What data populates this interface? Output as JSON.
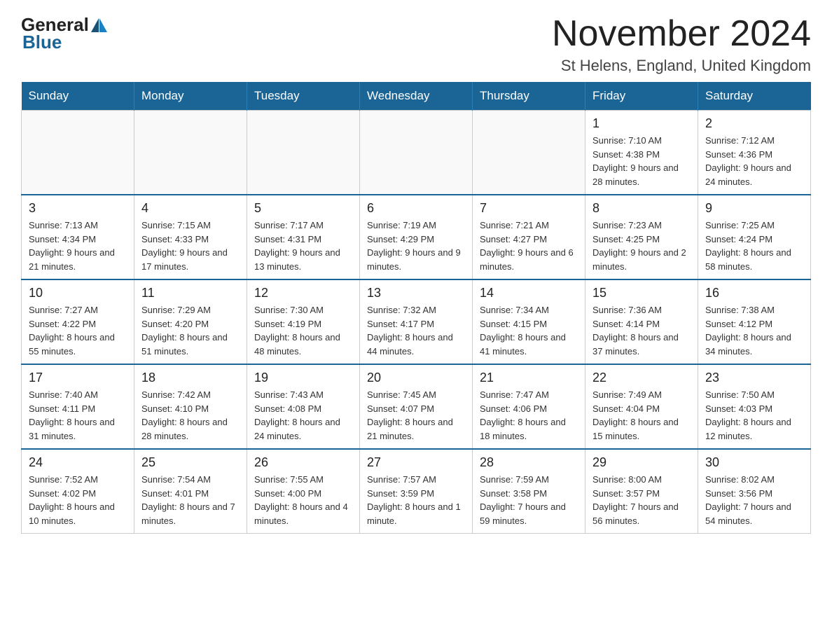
{
  "header": {
    "logo_general": "General",
    "logo_blue": "Blue",
    "month_title": "November 2024",
    "location": "St Helens, England, United Kingdom"
  },
  "calendar": {
    "days_of_week": [
      "Sunday",
      "Monday",
      "Tuesday",
      "Wednesday",
      "Thursday",
      "Friday",
      "Saturday"
    ],
    "weeks": [
      [
        {
          "day": "",
          "info": ""
        },
        {
          "day": "",
          "info": ""
        },
        {
          "day": "",
          "info": ""
        },
        {
          "day": "",
          "info": ""
        },
        {
          "day": "",
          "info": ""
        },
        {
          "day": "1",
          "info": "Sunrise: 7:10 AM\nSunset: 4:38 PM\nDaylight: 9 hours and 28 minutes."
        },
        {
          "day": "2",
          "info": "Sunrise: 7:12 AM\nSunset: 4:36 PM\nDaylight: 9 hours and 24 minutes."
        }
      ],
      [
        {
          "day": "3",
          "info": "Sunrise: 7:13 AM\nSunset: 4:34 PM\nDaylight: 9 hours and 21 minutes."
        },
        {
          "day": "4",
          "info": "Sunrise: 7:15 AM\nSunset: 4:33 PM\nDaylight: 9 hours and 17 minutes."
        },
        {
          "day": "5",
          "info": "Sunrise: 7:17 AM\nSunset: 4:31 PM\nDaylight: 9 hours and 13 minutes."
        },
        {
          "day": "6",
          "info": "Sunrise: 7:19 AM\nSunset: 4:29 PM\nDaylight: 9 hours and 9 minutes."
        },
        {
          "day": "7",
          "info": "Sunrise: 7:21 AM\nSunset: 4:27 PM\nDaylight: 9 hours and 6 minutes."
        },
        {
          "day": "8",
          "info": "Sunrise: 7:23 AM\nSunset: 4:25 PM\nDaylight: 9 hours and 2 minutes."
        },
        {
          "day": "9",
          "info": "Sunrise: 7:25 AM\nSunset: 4:24 PM\nDaylight: 8 hours and 58 minutes."
        }
      ],
      [
        {
          "day": "10",
          "info": "Sunrise: 7:27 AM\nSunset: 4:22 PM\nDaylight: 8 hours and 55 minutes."
        },
        {
          "day": "11",
          "info": "Sunrise: 7:29 AM\nSunset: 4:20 PM\nDaylight: 8 hours and 51 minutes."
        },
        {
          "day": "12",
          "info": "Sunrise: 7:30 AM\nSunset: 4:19 PM\nDaylight: 8 hours and 48 minutes."
        },
        {
          "day": "13",
          "info": "Sunrise: 7:32 AM\nSunset: 4:17 PM\nDaylight: 8 hours and 44 minutes."
        },
        {
          "day": "14",
          "info": "Sunrise: 7:34 AM\nSunset: 4:15 PM\nDaylight: 8 hours and 41 minutes."
        },
        {
          "day": "15",
          "info": "Sunrise: 7:36 AM\nSunset: 4:14 PM\nDaylight: 8 hours and 37 minutes."
        },
        {
          "day": "16",
          "info": "Sunrise: 7:38 AM\nSunset: 4:12 PM\nDaylight: 8 hours and 34 minutes."
        }
      ],
      [
        {
          "day": "17",
          "info": "Sunrise: 7:40 AM\nSunset: 4:11 PM\nDaylight: 8 hours and 31 minutes."
        },
        {
          "day": "18",
          "info": "Sunrise: 7:42 AM\nSunset: 4:10 PM\nDaylight: 8 hours and 28 minutes."
        },
        {
          "day": "19",
          "info": "Sunrise: 7:43 AM\nSunset: 4:08 PM\nDaylight: 8 hours and 24 minutes."
        },
        {
          "day": "20",
          "info": "Sunrise: 7:45 AM\nSunset: 4:07 PM\nDaylight: 8 hours and 21 minutes."
        },
        {
          "day": "21",
          "info": "Sunrise: 7:47 AM\nSunset: 4:06 PM\nDaylight: 8 hours and 18 minutes."
        },
        {
          "day": "22",
          "info": "Sunrise: 7:49 AM\nSunset: 4:04 PM\nDaylight: 8 hours and 15 minutes."
        },
        {
          "day": "23",
          "info": "Sunrise: 7:50 AM\nSunset: 4:03 PM\nDaylight: 8 hours and 12 minutes."
        }
      ],
      [
        {
          "day": "24",
          "info": "Sunrise: 7:52 AM\nSunset: 4:02 PM\nDaylight: 8 hours and 10 minutes."
        },
        {
          "day": "25",
          "info": "Sunrise: 7:54 AM\nSunset: 4:01 PM\nDaylight: 8 hours and 7 minutes."
        },
        {
          "day": "26",
          "info": "Sunrise: 7:55 AM\nSunset: 4:00 PM\nDaylight: 8 hours and 4 minutes."
        },
        {
          "day": "27",
          "info": "Sunrise: 7:57 AM\nSunset: 3:59 PM\nDaylight: 8 hours and 1 minute."
        },
        {
          "day": "28",
          "info": "Sunrise: 7:59 AM\nSunset: 3:58 PM\nDaylight: 7 hours and 59 minutes."
        },
        {
          "day": "29",
          "info": "Sunrise: 8:00 AM\nSunset: 3:57 PM\nDaylight: 7 hours and 56 minutes."
        },
        {
          "day": "30",
          "info": "Sunrise: 8:02 AM\nSunset: 3:56 PM\nDaylight: 7 hours and 54 minutes."
        }
      ]
    ]
  }
}
